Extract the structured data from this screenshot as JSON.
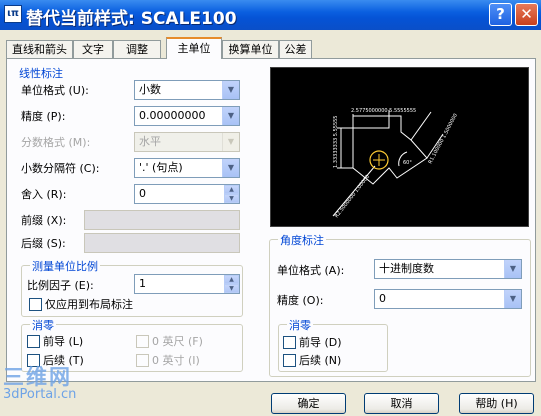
{
  "window": {
    "title": "替代当前样式: SCALE100",
    "icon_text": "ιπ",
    "help_glyph": "?",
    "close_glyph": "✕"
  },
  "tabs": [
    {
      "label": "直线和箭头",
      "active": false
    },
    {
      "label": "文字",
      "active": false
    },
    {
      "label": "调整",
      "active": false
    },
    {
      "label": "主单位",
      "active": true
    },
    {
      "label": "换算单位",
      "active": false
    },
    {
      "label": "公差",
      "active": false
    }
  ],
  "linear": {
    "title": "线性标注",
    "unit_format": {
      "label": "单位格式 (U):",
      "value": "小数"
    },
    "precision": {
      "label": "精度 (P):",
      "value": "0.00000000"
    },
    "fraction_format": {
      "label": "分数格式 (M):",
      "value": "水平"
    },
    "decimal_separator": {
      "label": "小数分隔符 (C):",
      "value": "'.' (句点)"
    },
    "round_off": {
      "label": "舍入 (R):",
      "value": "0"
    },
    "prefix": {
      "label": "前缀 (X):",
      "value": ""
    },
    "suffix": {
      "label": "后缀 (S):",
      "value": ""
    }
  },
  "scale": {
    "title": "测量单位比例",
    "factor": {
      "label": "比例因子 (E):",
      "value": "1"
    },
    "layout_only": {
      "label": "仅应用到布局标注",
      "checked": false
    }
  },
  "zero_left": {
    "title": "消零",
    "leading": {
      "label": "前导 (L)",
      "checked": false
    },
    "trailing": {
      "label": "后续 (T)",
      "checked": false
    },
    "feet": {
      "label": "0 英尺 (F)",
      "checked": false
    },
    "inches": {
      "label": "0 英寸 (I)",
      "checked": false
    }
  },
  "angular": {
    "title": "角度标注",
    "unit_format": {
      "label": "单位格式 (A):",
      "value": "十进制度数"
    },
    "precision": {
      "label": "精度 (O):",
      "value": "0"
    }
  },
  "zero_right": {
    "title": "消零",
    "leading": {
      "label": "前导 (D)",
      "checked": false
    },
    "trailing": {
      "label": "后续 (N)",
      "checked": false
    }
  },
  "preview_labels": {
    "top": "2.5775000000 5.5555555",
    "left": "1.33333333 5.55555",
    "right": "R1.100000 1.5000000",
    "bottom": "R2.5000000 1.00000",
    "angle": "60°"
  },
  "buttons": {
    "ok": "确定",
    "cancel": "取消",
    "help": "帮助 (H)"
  },
  "watermark": {
    "top": "三维网",
    "bottom": "3dPortal.cn"
  },
  "colors": {
    "title_bar": "#0553d6",
    "group_title": "#0046d5",
    "active_tab_accent": "#e68b2c"
  }
}
